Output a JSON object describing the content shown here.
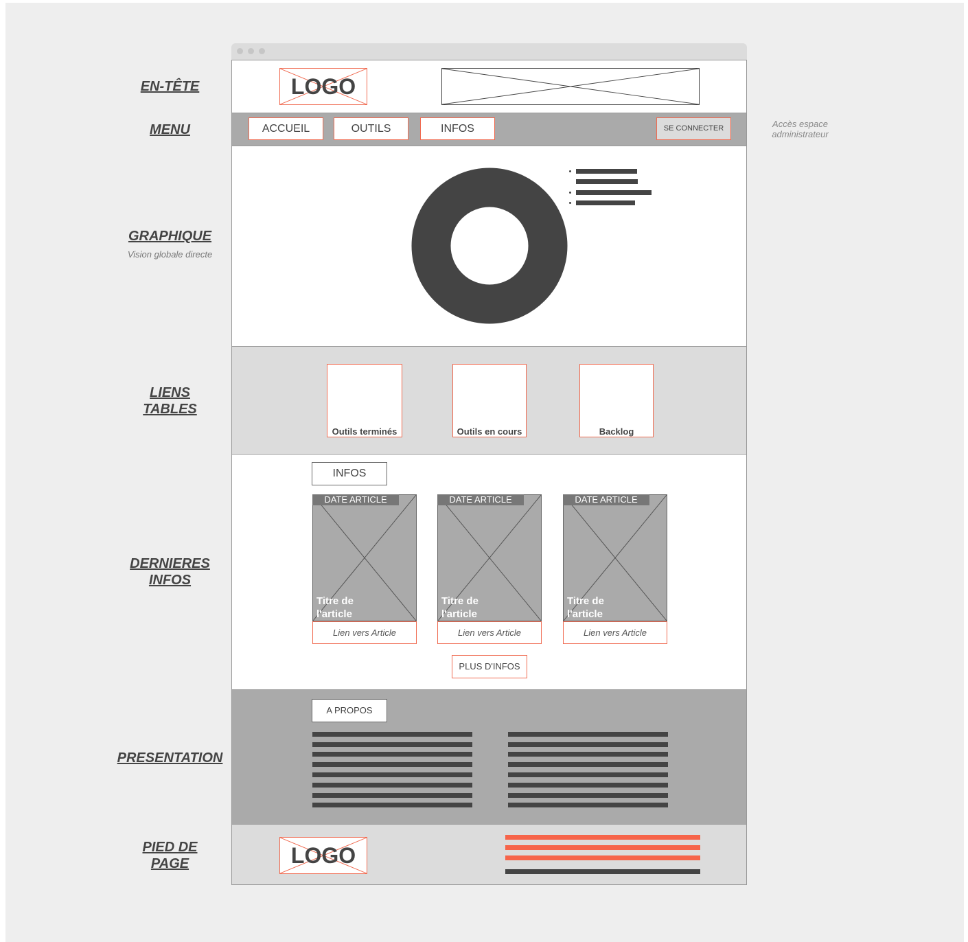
{
  "labels": {
    "header": "EN-TÊTE",
    "menu": "MENU",
    "chart": "GRAPHIQUE",
    "chart_sub": "Vision globale directe",
    "links_line1": "LIENS ",
    "links_line2": "TABLES",
    "news_line1": "DERNIERES ",
    "news_line2": "INFOS",
    "presentation": "PRESENTATION",
    "footer_line1": "PIED DE ",
    "footer_line2": "PAGE"
  },
  "admin_note_line1": "Accès espace",
  "admin_note_line2": "administrateur",
  "header": {
    "logo": "LOGO"
  },
  "menu": {
    "items": [
      "ACCUEIL",
      "OUTILS",
      "INFOS"
    ],
    "login": "SE CONNECTER"
  },
  "tables": [
    "Outils terminés",
    "Outils en cours",
    "Backlog"
  ],
  "news": {
    "title": "INFOS",
    "cards": [
      {
        "date": "DATE ARTICLE",
        "title_line1": "Titre de",
        "title_line2": "l'article",
        "link": "Lien vers Article"
      },
      {
        "date": "DATE ARTICLE",
        "title_line1": "Titre de",
        "title_line2": "l'article",
        "link": "Lien vers Article"
      },
      {
        "date": "DATE ARTICLE",
        "title_line1": "Titre de",
        "title_line2": "l'article",
        "link": "Lien vers Article"
      }
    ],
    "more": "PLUS D'INFOS"
  },
  "about": {
    "title": "A PROPOS"
  },
  "footer": {
    "logo": "LOGO"
  },
  "colors": {
    "accent": "#f6644a",
    "dark": "#444444",
    "mid_gray": "#aaaaaa",
    "light_gray": "#dcdcdc"
  }
}
